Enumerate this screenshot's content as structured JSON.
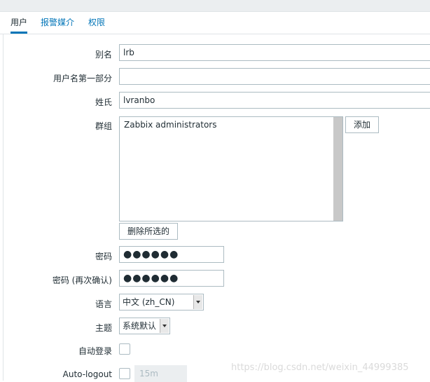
{
  "tabs": [
    {
      "label": "用户",
      "active": true
    },
    {
      "label": "报警媒介",
      "active": false
    },
    {
      "label": "权限",
      "active": false
    }
  ],
  "form": {
    "alias": {
      "label": "别名",
      "value": "lrb"
    },
    "name": {
      "label": "用户名第一部分",
      "value": ""
    },
    "surname": {
      "label": "姓氏",
      "value": "lvranbo"
    },
    "groups": {
      "label": "群组",
      "items": [
        "Zabbix administrators"
      ],
      "add_button": "添加",
      "remove_button": "删除所选的"
    },
    "password": {
      "label": "密码",
      "value": "●●●●●●"
    },
    "password_confirm": {
      "label": "密码 (再次确认)",
      "value": "●●●●●●"
    },
    "language": {
      "label": "语言",
      "value": "中文 (zh_CN)"
    },
    "theme": {
      "label": "主题",
      "value": "系统默认"
    },
    "autologin": {
      "label": "自动登录",
      "checked": false
    },
    "autologout": {
      "label": "Auto-logout",
      "checked": false,
      "value": "15m"
    }
  },
  "watermark": "https://blog.csdn.net/weixin_44999385",
  "colors": {
    "accent": "#0275b8",
    "border": "#acbbc2"
  }
}
